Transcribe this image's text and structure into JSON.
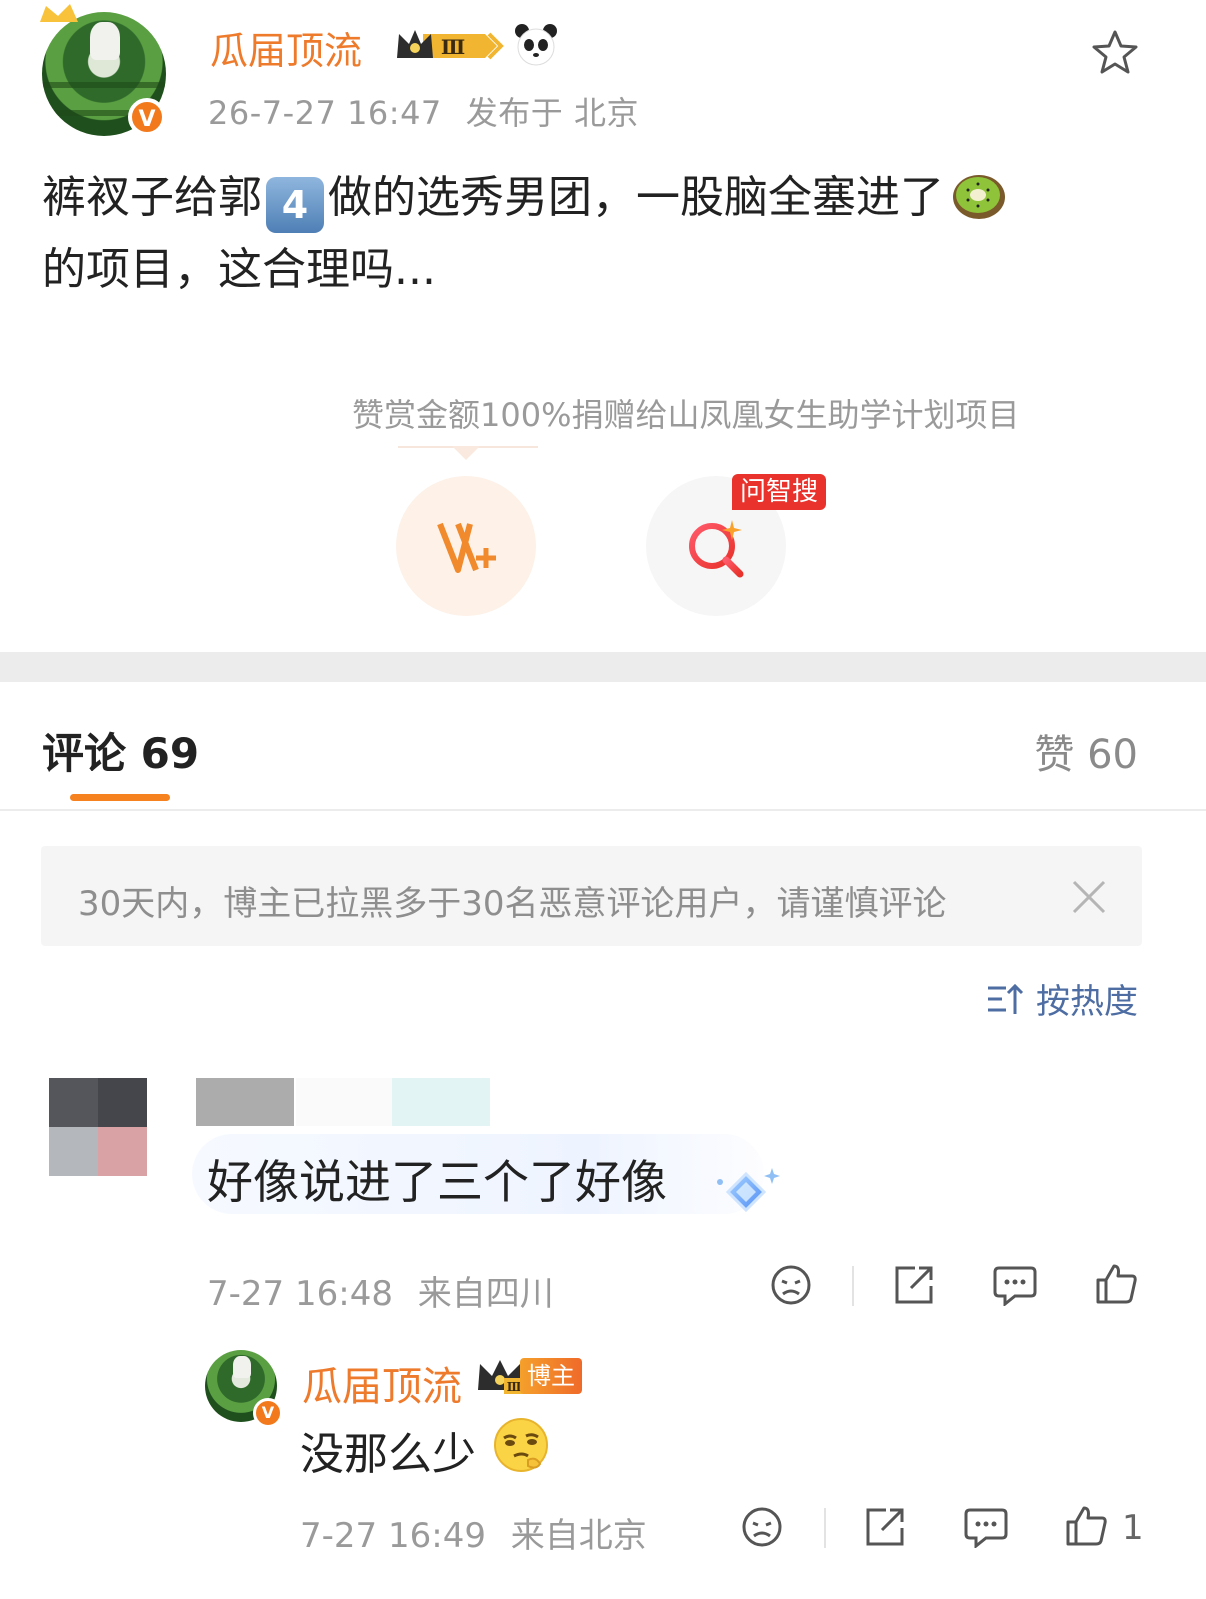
{
  "post": {
    "author": "瓜届顶流",
    "time": "26-7-27 16:47",
    "location": "发布于 北京",
    "text_part1": "裤衩子给郭",
    "keycap": "4",
    "text_part2": "做的选秀男团，一股脑全塞进了",
    "text_part3": "的项目，这合理吗...",
    "crown_level": "Ⅲ",
    "reward_note": "赞赏金额100%捐赠给山凤凰女生助学计划项目",
    "ai_search_tag": "问智搜",
    "reward_button_glyph": "V+",
    "vbadge_glyph": "V"
  },
  "comments_header": {
    "tab_comments": "评论 69",
    "tab_likes": "赞 60"
  },
  "notice": {
    "text": "30天内，博主已拉黑多于30名恶意评论用户，请谨慎评论"
  },
  "sort": {
    "label": "按热度"
  },
  "comments": [
    {
      "text": "好像说进了三个了好像",
      "time": "7-27 16:48",
      "location": "来自四川"
    }
  ],
  "reply": {
    "author": "瓜届顶流",
    "host_tag": "博主",
    "text": "没那么少",
    "time": "7-27 16:49",
    "location": "来自北京",
    "like_count": "1",
    "crown_level": "Ⅲ"
  },
  "colors": {
    "accent": "#f5821f",
    "username": "#ee7a2c",
    "link_blue": "#4d6da3",
    "ai_tag_red": "#e8322b"
  }
}
